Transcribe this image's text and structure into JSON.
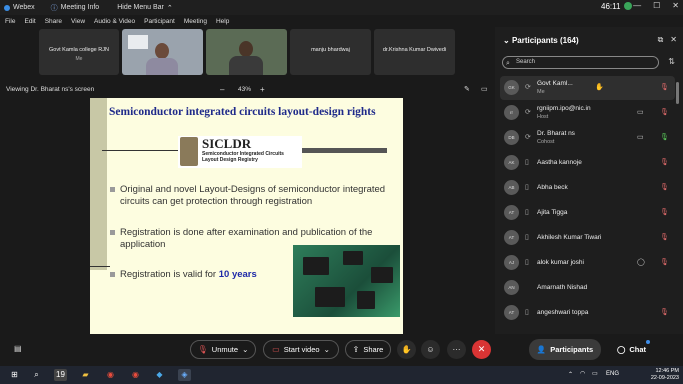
{
  "titlebar": {
    "app": "Webex",
    "meeting_info": "Meeting Info",
    "hide_menu": "Hide Menu Bar",
    "timer": "46:11"
  },
  "menu": [
    "File",
    "Edit",
    "Share",
    "View",
    "Audio & Video",
    "Participant",
    "Meeting",
    "Help"
  ],
  "tiles": [
    {
      "name": "Govt Kamla college RJN",
      "sub": "Me"
    },
    {
      "name": "",
      "sub": ""
    },
    {
      "name": "",
      "sub": ""
    },
    {
      "name": "manju bhardwaj",
      "sub": ""
    },
    {
      "name": "dr.Krishna Kumar Dwivedi",
      "sub": ""
    }
  ],
  "viewbar": {
    "viewing": "Viewing Dr. Bharat ns's screen",
    "zoom": "43%",
    "minus": "–",
    "plus": "+"
  },
  "slide": {
    "title": "Semiconductor integrated circuits layout-design rights",
    "logo_title": "SICLDR",
    "logo_sub1": "Semiconductor Integrated Circuits",
    "logo_sub2": "Layout Design Registry",
    "bullets": [
      "Original and novel Layout-Designs of semiconductor integrated circuits can get protection through registration",
      "Registration is done after examination and publication of the application"
    ],
    "bullet3_prefix": "Registration is valid for ",
    "bullet3_highlight": "10 years"
  },
  "panel": {
    "header": "Participants (164)",
    "search_placeholder": "Search",
    "participants": [
      {
        "initials": "GK",
        "name": "Govt Kaml...",
        "role": "Me",
        "icon1": "✋",
        "icon2": "mic-muted"
      },
      {
        "initials": "rr",
        "name": "rgniipm.ipo@nic.in",
        "role": "Host",
        "icon1": "video",
        "icon2": "mic-muted"
      },
      {
        "initials": "DB",
        "name": "Dr. Bharat ns",
        "role": "Cohost",
        "icon1": "video",
        "icon2": "mic-on"
      },
      {
        "initials": "AK",
        "name": "Aastha kannoje",
        "role": "",
        "icon1": "",
        "icon2": "mic-muted"
      },
      {
        "initials": "AB",
        "name": "Abha beck",
        "role": "",
        "icon1": "",
        "icon2": "mic-muted"
      },
      {
        "initials": "AT",
        "name": "Ajita Tigga",
        "role": "",
        "icon1": "",
        "icon2": "mic-muted"
      },
      {
        "initials": "AT",
        "name": "Akhilesh Kumar Tiwari",
        "role": "",
        "icon1": "",
        "icon2": "mic-muted"
      },
      {
        "initials": "AJ",
        "name": "alok kumar joshi",
        "role": "",
        "icon1": "chat",
        "icon2": "mic-muted"
      },
      {
        "initials": "AN",
        "name": "Amarnath Nishad",
        "role": "",
        "icon1": "",
        "icon2": ""
      },
      {
        "initials": "AT",
        "name": "angeshwari toppa",
        "role": "",
        "icon1": "",
        "icon2": "mic-muted"
      }
    ]
  },
  "controls": {
    "unmute": "Unmute",
    "start_video": "Start video",
    "share": "Share",
    "more": "···",
    "participants": "Participants",
    "chat": "Chat"
  },
  "taskbar": {
    "date_badge": "19",
    "lang": "ENG",
    "time": "12:46 PM",
    "date": "22-09-2023"
  }
}
